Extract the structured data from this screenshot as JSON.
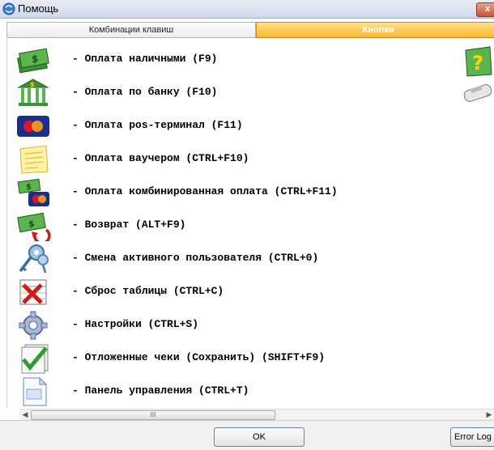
{
  "window": {
    "title": "Помощь",
    "close_label": "x"
  },
  "tabs": [
    {
      "label": "Комбинации клавиш"
    },
    {
      "label": "Кнопки"
    }
  ],
  "items": [
    {
      "icon": "cash-money-icon",
      "text": "- Оплата наличными (F9)"
    },
    {
      "icon": "bank-icon",
      "text": "- Оплата по банку (F10)"
    },
    {
      "icon": "pos-terminal-card-icon",
      "text": "- Оплата pos-терминал (F11)"
    },
    {
      "icon": "voucher-note-icon",
      "text": "- Оплата ваучером (CTRL+F10)"
    },
    {
      "icon": "combined-payment-icon",
      "text": "- Оплата комбинированная оплата (CTRL+F11)"
    },
    {
      "icon": "refund-icon",
      "text": "- Возврат (ALT+F9)"
    },
    {
      "icon": "keys-user-icon",
      "text": "- Смена активного пользователя (CTRL+0)"
    },
    {
      "icon": "clear-table-icon",
      "text": "- Сброс таблицы (CTRL+C)"
    },
    {
      "icon": "settings-gear-icon",
      "text": "- Настройки (CTRL+S)"
    },
    {
      "icon": "deferred-checks-icon",
      "text": "- Отложенные чеки (Сохранить) (SHIFT+F9)"
    },
    {
      "icon": "control-panel-icon",
      "text": "- Панель управления (CTRL+T)"
    }
  ],
  "side_icons": [
    "help-icon",
    "card-reader-icon"
  ],
  "scrollbar": {
    "thumb_label": "III"
  },
  "footer": {
    "ok_label": "OK",
    "error_log_label": "Error Log"
  },
  "colors": {
    "active_tab": "#f7b733",
    "title_bar": "#cfd8ea",
    "close_button": "#c8553c"
  }
}
